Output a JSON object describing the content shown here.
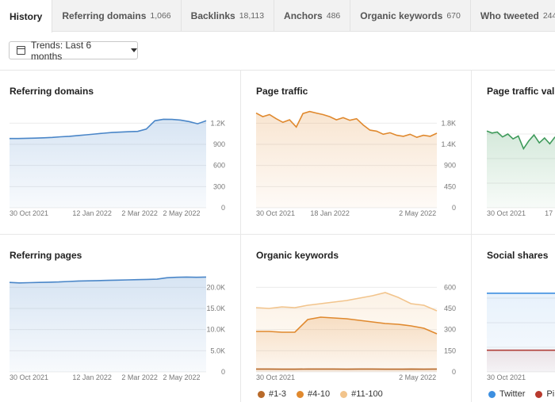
{
  "tabs": [
    {
      "label": "History",
      "count": null,
      "active": true
    },
    {
      "label": "Referring domains",
      "count": "1,066"
    },
    {
      "label": "Backlinks",
      "count": "18,113"
    },
    {
      "label": "Anchors",
      "count": "486"
    },
    {
      "label": "Organic keywords",
      "count": "670"
    },
    {
      "label": "Who tweeted",
      "count": "244"
    }
  ],
  "trend_button": {
    "label": "Trends: Last 6 months"
  },
  "colors": {
    "blue": "#4a86c8",
    "orange": "#e0892e",
    "light_orange": "#f2c48c",
    "dark_orange": "#b86a2a",
    "green": "#3e9a5a",
    "red": "#b83a2e",
    "twitter": "#3d8fe0"
  },
  "chart_data": [
    {
      "id": "referring-domains",
      "type": "area",
      "title": "Referring domains",
      "x_ticks": [
        "30 Oct 2021",
        "12 Jan 2022",
        "2 Mar 2022",
        "2 May 2022"
      ],
      "y_ticks": [
        "1.2K",
        "900",
        "600",
        "300",
        "0"
      ],
      "ylim": [
        0,
        1300
      ],
      "series": [
        {
          "name": "Referring domains",
          "color": "#4a86c8",
          "values": [
            915,
            915,
            918,
            920,
            925,
            930,
            938,
            945,
            955,
            965,
            975,
            985,
            995,
            1000,
            1005,
            1010,
            1040,
            1150,
            1170,
            1168,
            1160,
            1140,
            1110,
            1150
          ]
        }
      ]
    },
    {
      "id": "page-traffic",
      "type": "area",
      "title": "Page traffic",
      "x_ticks": [
        "30 Oct 2021",
        "18 Jan 2022",
        "2 May 2022"
      ],
      "y_ticks": [
        "1.8K",
        "1.4K",
        "900",
        "450",
        "0"
      ],
      "ylim": [
        0,
        1900
      ],
      "series": [
        {
          "name": "Page traffic",
          "color": "#e0892e",
          "values": [
            1830,
            1760,
            1800,
            1720,
            1650,
            1700,
            1560,
            1820,
            1860,
            1830,
            1800,
            1760,
            1700,
            1740,
            1690,
            1720,
            1600,
            1500,
            1480,
            1420,
            1450,
            1400,
            1380,
            1420,
            1360,
            1400,
            1380,
            1440
          ]
        }
      ]
    },
    {
      "id": "page-traffic-value",
      "type": "area",
      "title": "Page traffic valu",
      "x_ticks": [
        "30 Oct 2021",
        "17"
      ],
      "y_ticks": [],
      "ylim": [
        0,
        100
      ],
      "series": [
        {
          "name": "Page traffic value",
          "color": "#3e9a5a",
          "values": [
            78,
            76,
            77,
            72,
            75,
            70,
            73,
            60,
            68,
            74,
            66,
            71,
            65,
            72
          ]
        }
      ]
    },
    {
      "id": "referring-pages",
      "type": "area",
      "title": "Referring pages",
      "x_ticks": [
        "30 Oct 2021",
        "12 Jan 2022",
        "2 Mar 2022",
        "2 May 2022"
      ],
      "y_ticks": [
        "20.0K",
        "15.0K",
        "10.0K",
        "5.0K",
        "0"
      ],
      "ylim": [
        0,
        21000
      ],
      "series": [
        {
          "name": "Referring pages",
          "color": "#4a86c8",
          "values": [
            19100,
            19000,
            19050,
            19100,
            19150,
            19200,
            19300,
            19400,
            19450,
            19500,
            19550,
            19600,
            19650,
            19700,
            19750,
            19800,
            20100,
            20200,
            20250,
            20200,
            20250
          ]
        }
      ]
    },
    {
      "id": "organic-keywords",
      "type": "area",
      "title": "Organic keywords",
      "x_ticks": [
        "30 Oct 2021",
        "2 May 2022"
      ],
      "y_ticks": [
        "600",
        "450",
        "300",
        "150",
        "0"
      ],
      "ylim": [
        0,
        620
      ],
      "legend": [
        "#1-3",
        "#4-10",
        "#11-100"
      ],
      "series": [
        {
          "name": "#1-3",
          "color": "#b86a2a",
          "values": [
            18,
            18,
            17,
            17,
            18,
            18,
            18,
            17,
            18,
            18,
            17,
            17,
            18,
            17,
            18
          ]
        },
        {
          "name": "#4-10",
          "color": "#e0892e",
          "values": [
            255,
            255,
            250,
            250,
            330,
            345,
            340,
            335,
            325,
            315,
            305,
            300,
            290,
            275,
            240
          ]
        },
        {
          "name": "#11-100",
          "color": "#f2c48c",
          "values": [
            405,
            400,
            410,
            405,
            420,
            430,
            440,
            450,
            465,
            480,
            500,
            470,
            430,
            420,
            385
          ]
        }
      ]
    },
    {
      "id": "social-shares",
      "type": "line",
      "title": "Social shares",
      "x_ticks": [
        "30 Oct 2021"
      ],
      "y_ticks": [],
      "ylim": [
        0,
        100
      ],
      "legend": [
        "Twitter",
        "Pi"
      ],
      "series": [
        {
          "name": "Twitter",
          "color": "#3d8fe0",
          "values": [
            80,
            80,
            80
          ]
        },
        {
          "name": "Pinterest",
          "color": "#b83a2e",
          "values": [
            22,
            22,
            22
          ]
        }
      ]
    }
  ]
}
